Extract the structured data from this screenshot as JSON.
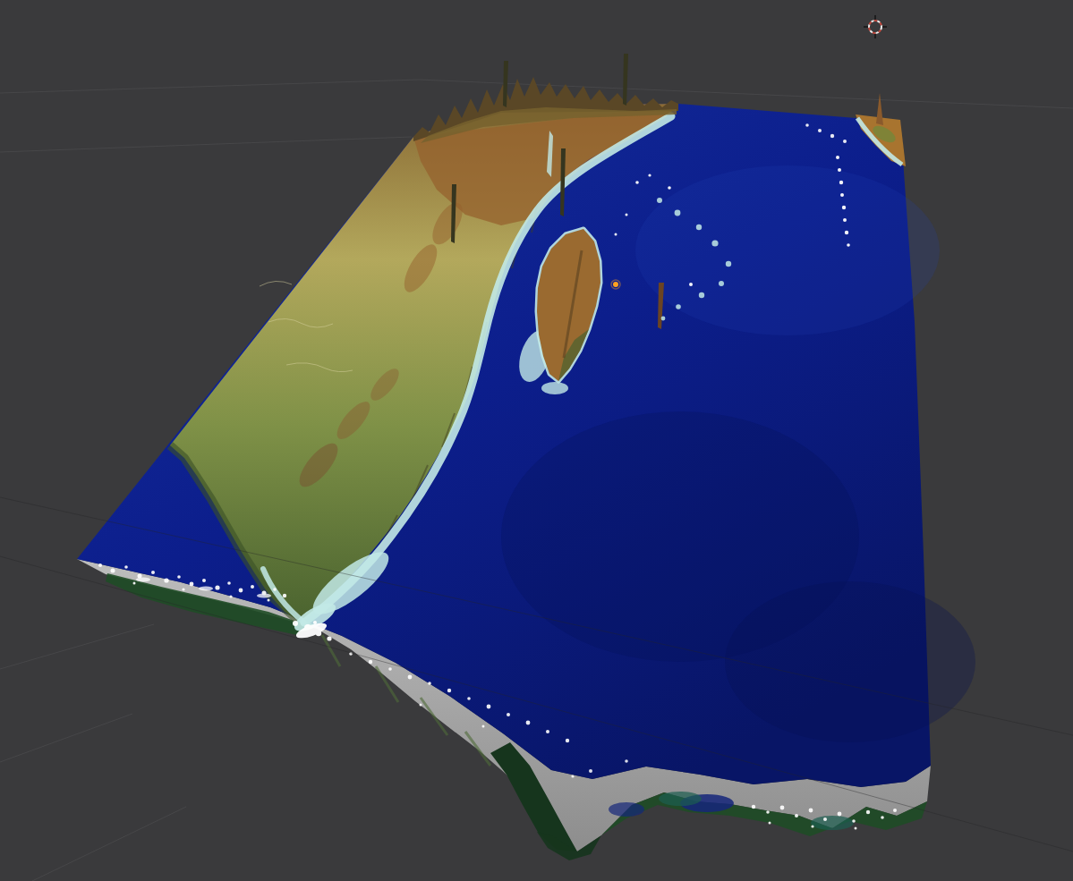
{
  "viewport": {
    "kind": "3d-viewport",
    "background_color": "#3a3a3c",
    "grid": {
      "line_color": "#4a4a4c",
      "dark_line_color": "#242426"
    },
    "cursor_3d": {
      "ring_red": "#c2483e",
      "ring_white": "#e9e9e9",
      "tick_color": "#141414"
    },
    "origin_dot_color": "#ffa21f"
  },
  "scene": {
    "label": "extruded-terrain-heightmap-southern-africa-madagascar-indian-ocean",
    "colors": {
      "ocean_top": "#16309e",
      "ocean_mid": "#0c1e8c",
      "ocean_deep": "#081566",
      "ocean_sheen": "#2240b8",
      "ocean_shadow": "#050f52",
      "shallow_water": "#c2e9e6",
      "cloud_white": "#ffffff",
      "land_tan": "#8a6a34",
      "land_yellow": "#b3a85c",
      "land_green": "#7f9147",
      "land_dark_green": "#4a632f",
      "land_north_brown": "#96622e",
      "land_orange": "#a8742f",
      "mountain_dark": "#5a4726",
      "mountain_olive": "#77622e",
      "island_brown": "#9a6a30",
      "spike_dark": "#35351f",
      "reunion_spike": "#6b4423",
      "face_gray_light": "#bdbdbd",
      "face_gray_dark": "#8d8d8d",
      "fringe_green": "#1f4d26",
      "fringe_dark": "#16351d",
      "fringe_teal": "#1c5e50",
      "fringe_navy": "#15267a",
      "contour_line": "#d8d2a0",
      "west_shade_green": "#3a5026"
    },
    "speckles": {
      "clouds_southwest": [
        [
          112,
          632,
          2
        ],
        [
          126,
          638,
          2.5
        ],
        [
          141,
          634,
          1.8
        ],
        [
          156,
          644,
          2.5
        ],
        [
          171,
          640,
          2
        ],
        [
          186,
          649,
          2.6
        ],
        [
          200,
          645,
          1.8
        ],
        [
          214,
          653,
          2.4
        ],
        [
          228,
          649,
          2
        ],
        [
          243,
          657,
          2.6
        ],
        [
          256,
          652,
          1.8
        ],
        [
          269,
          660,
          2.4
        ],
        [
          282,
          656,
          2
        ],
        [
          295,
          663,
          2.5
        ],
        [
          307,
          659,
          1.8
        ],
        [
          318,
          666,
          2.2
        ],
        [
          150,
          652,
          1.5
        ],
        [
          205,
          659,
          1.6
        ],
        [
          258,
          667,
          1.6
        ],
        [
          300,
          671,
          1.5
        ]
      ],
      "clouds_front_face": [
        [
          392,
          731,
          1.8
        ],
        [
          414,
          740,
          2.2
        ],
        [
          436,
          748,
          1.8
        ],
        [
          458,
          757,
          2.4
        ],
        [
          480,
          764,
          1.8
        ],
        [
          502,
          772,
          2.2
        ],
        [
          524,
          781,
          1.8
        ],
        [
          546,
          790,
          2.4
        ],
        [
          568,
          799,
          2
        ],
        [
          590,
          808,
          2.4
        ],
        [
          612,
          818,
          2
        ],
        [
          634,
          828,
          2.2
        ],
        [
          470,
          788,
          1.5
        ],
        [
          540,
          812,
          1.5
        ]
      ],
      "cape_cluster": [
        [
          330,
          697,
          3
        ],
        [
          344,
          702,
          4
        ],
        [
          356,
          708,
          3.2
        ],
        [
          368,
          714,
          2.6
        ],
        [
          352,
          696,
          2
        ],
        [
          338,
          708,
          2
        ]
      ],
      "clouds_bottom_right": [
        [
          842,
          902,
          2.2
        ],
        [
          858,
          908,
          1.8
        ],
        [
          874,
          903,
          2.4
        ],
        [
          890,
          912,
          2
        ],
        [
          906,
          906,
          2.4
        ],
        [
          922,
          916,
          2
        ],
        [
          938,
          910,
          2.4
        ],
        [
          954,
          918,
          1.8
        ],
        [
          970,
          908,
          2.2
        ],
        [
          986,
          914,
          1.8
        ],
        [
          1000,
          906,
          2
        ],
        [
          860,
          920,
          1.5
        ],
        [
          908,
          924,
          1.6
        ],
        [
          956,
          926,
          1.5
        ]
      ],
      "ocean_islands_white": [
        [
          712,
          204,
          1.8
        ],
        [
          726,
          196,
          1.6
        ],
        [
          748,
          210,
          1.8
        ],
        [
          772,
          318,
          2
        ],
        [
          700,
          240,
          1.5
        ],
        [
          688,
          262,
          1.5
        ]
      ],
      "island_arc_cyan": [
        [
          737,
          224,
          3
        ],
        [
          757,
          238,
          3.4
        ],
        [
          781,
          254,
          3.2
        ],
        [
          799,
          272,
          3.6
        ],
        [
          814,
          295,
          3.2
        ],
        [
          806,
          317,
          3
        ],
        [
          784,
          330,
          3.2
        ],
        [
          758,
          343,
          2.8
        ],
        [
          741,
          356,
          2.4
        ]
      ],
      "maldives_chain": [
        [
          936,
          176,
          2
        ],
        [
          938,
          190,
          2
        ],
        [
          940,
          204,
          2.2
        ],
        [
          941,
          218,
          2
        ],
        [
          943,
          232,
          2.2
        ],
        [
          944,
          246,
          2
        ],
        [
          946,
          260,
          2.2
        ],
        [
          948,
          274,
          1.8
        ]
      ],
      "india_coast_specks": [
        [
          902,
          140,
          1.8
        ],
        [
          916,
          146,
          2
        ],
        [
          930,
          152,
          2.2
        ],
        [
          944,
          158,
          2
        ]
      ],
      "front_edge_ocean_specks": [
        [
          660,
          862,
          2
        ],
        [
          700,
          851,
          1.8
        ],
        [
          640,
          868,
          1.6
        ]
      ]
    }
  }
}
